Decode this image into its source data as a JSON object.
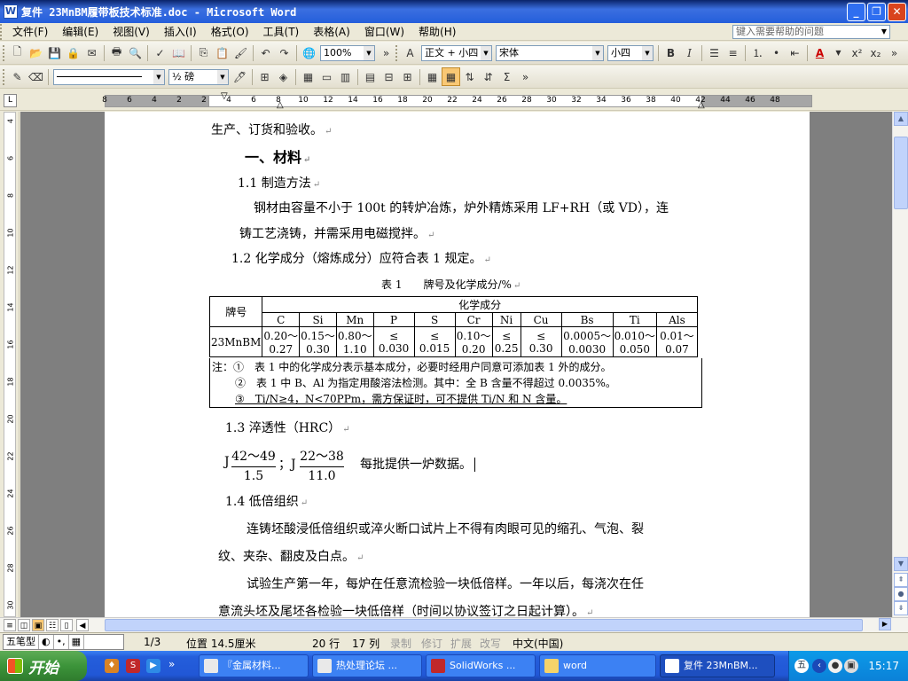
{
  "window": {
    "title": "复件 23MnBM履带板技术标准.doc - Microsoft Word",
    "icon_label": "W"
  },
  "menu": {
    "items": [
      "文件(F)",
      "编辑(E)",
      "视图(V)",
      "插入(I)",
      "格式(O)",
      "工具(T)",
      "表格(A)",
      "窗口(W)",
      "帮助(H)"
    ],
    "help_placeholder": "键入需要帮助的问题"
  },
  "toolbar": {
    "zoom": "100%",
    "style": "正文 + 小四",
    "font": "宋体",
    "size": "小四",
    "bold": "B",
    "italic": "I",
    "line_weight": "½ 磅",
    "font_color_letter": "A",
    "sum": "Σ"
  },
  "ruler": {
    "numbers": [
      "8",
      "6",
      "4",
      "2",
      "2",
      "4",
      "6",
      "8",
      "10",
      "12",
      "14",
      "16",
      "18",
      "20",
      "22",
      "24",
      "26",
      "28",
      "30",
      "32",
      "34",
      "36",
      "38",
      "40",
      "42",
      "44",
      "46",
      "48"
    ],
    "vnumbers": [
      "4",
      "6",
      "8",
      "10",
      "12",
      "14",
      "16",
      "18",
      "20",
      "22",
      "24",
      "26",
      "28",
      "30"
    ]
  },
  "document": {
    "line_production": "生产、订货和验收。",
    "heading_materials": "一、材料",
    "s11_title": "1.1 制造方法",
    "s11_p1": "钢材由容量不小于 100t 的转炉冶炼，炉外精炼采用 LF+RH（或 VD），连",
    "s11_p2": "铸工艺浇铸，并需采用电磁搅拌。",
    "s12_title": "1.2 化学成分（熔炼成分）应符合表 1 规定。",
    "table_caption": "表 1　　牌号及化学成分/%",
    "table": {
      "grade_header": "牌号",
      "composition_header": "化学成分",
      "elements": [
        "C",
        "Si",
        "Mn",
        "P",
        "S",
        "Cr",
        "Ni",
        "Cu",
        "Bs",
        "Ti",
        "Als"
      ],
      "grade": "23MnBM",
      "row_top": [
        "0.20～",
        "0.15～",
        "0.80～",
        "≤",
        "≤",
        "0.10～",
        "≤",
        "≤",
        "0.0005～",
        "0.010～",
        "0.01～"
      ],
      "row_bottom": [
        "0.27",
        "0.30",
        "1.10",
        "0.030",
        "0.015",
        "0.20",
        "0.25",
        "0.30",
        "0.0030",
        "0.050",
        "0.07"
      ]
    },
    "notes": [
      "注：①　表 1 中的化学成分表示基本成分，必要时经用户同意可添加表 1 外的成分。",
      "②　表 1 中 B、Al 为指定用酸溶法检测。其中：全 B 含量不得超过 0.0035%。",
      "③　Ti/N≥4，N<70PPm，需方保证时，可不提供 Ti/N 和 N 含量。"
    ],
    "s13_title": "1.3 淬透性（HRC）",
    "j1_prefix": "J",
    "j1_num": "42～49",
    "j1_den": "1.5",
    "j_sep": "；J",
    "j2_num": "22～38",
    "j2_den": "11.0",
    "j_suffix": "每批提供一炉数据。",
    "s14_title": "1.4 低倍组织",
    "s14_p1": "连铸坯酸浸低倍组织或淬火断口试片上不得有肉眼可见的缩孔、气泡、裂",
    "s14_p2": "纹、夹杂、翻皮及白点。",
    "s14_p3": "试验生产第一年，每炉在任意流检验一块低倍样。一年以后，每浇次在任",
    "s14_p4": "意流头坯及尾坯各检验一块低倍样（时间以协议签订之日起计算）。",
    "para_mark": "↵"
  },
  "status": {
    "ime": [
      "五笔型",
      "◐",
      "•,",
      "▦"
    ],
    "page": "1/3",
    "position": "位置 14.5厘米",
    "line": "20 行",
    "col": "17 列",
    "rec": "录制",
    "trk": "修订",
    "ext": "扩展",
    "ovr": "改写",
    "lang": "中文(中国)"
  },
  "taskbar": {
    "start": "开始",
    "tasks": [
      "『金属材料...",
      "热处理论坛 ...",
      "SolidWorks ...",
      "word",
      "复件 23MnBM..."
    ],
    "clock": "15:17"
  }
}
